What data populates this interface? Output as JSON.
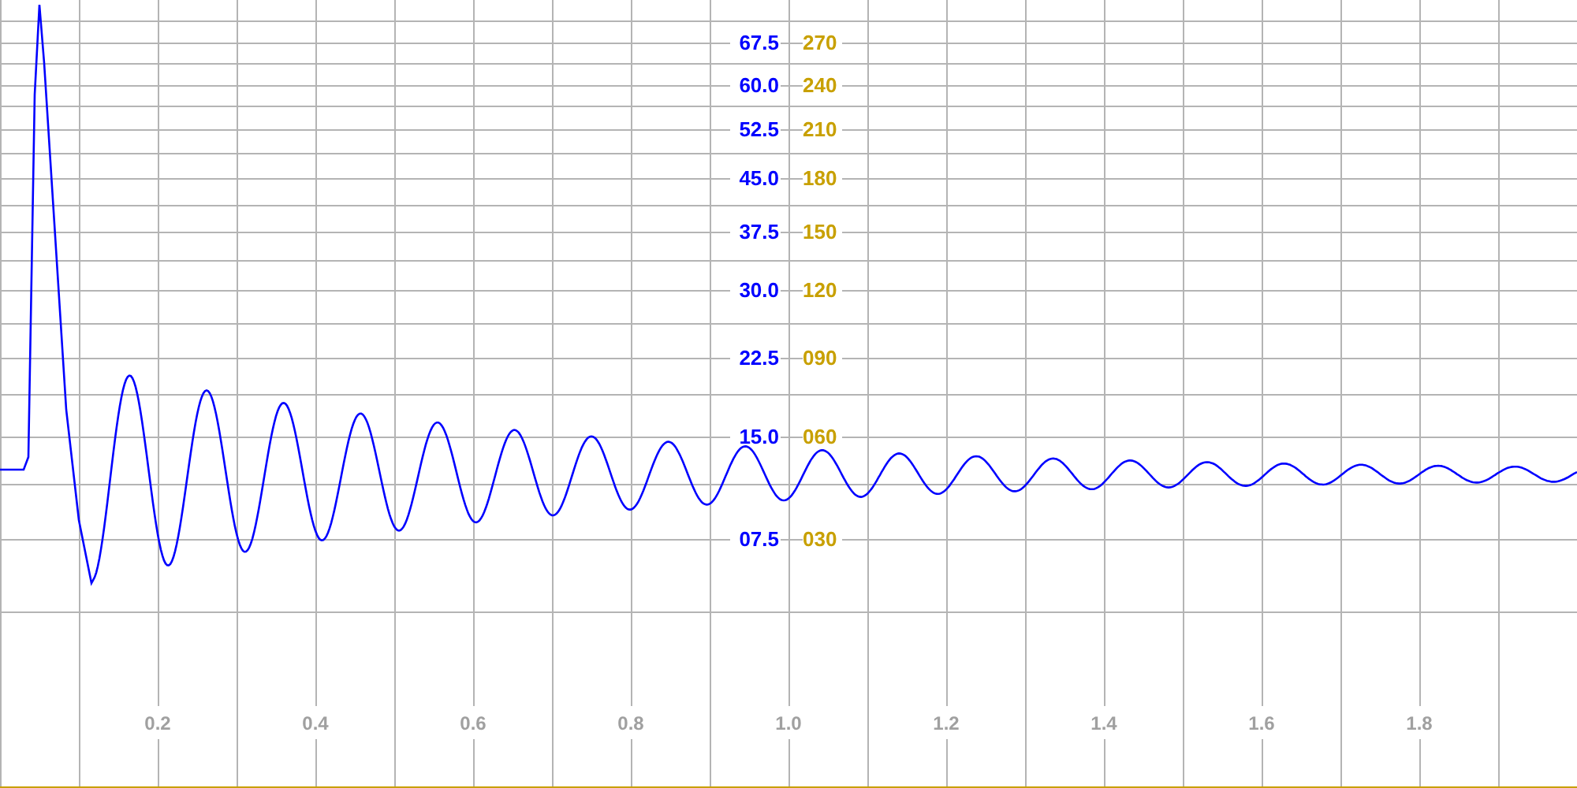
{
  "plot": {
    "left_scale": {
      "color": "#0000ff",
      "labels": [
        "67.5",
        "60.0",
        "52.5",
        "45.0",
        "37.5",
        "30.0",
        "22.5",
        "15.0",
        "07.5"
      ]
    },
    "right_scale": {
      "color": "#c8a000",
      "labels": [
        "270",
        "240",
        "210",
        "180",
        "150",
        "120",
        "090",
        "060",
        "030"
      ]
    },
    "x_scale": {
      "color": "#a0a0a0",
      "labels": [
        "0.2",
        "0.4",
        "0.6",
        "0.8",
        "1.0",
        "1.2",
        "1.4",
        "1.6",
        "1.8"
      ]
    },
    "trace": {
      "color": "#0000ff"
    }
  }
}
